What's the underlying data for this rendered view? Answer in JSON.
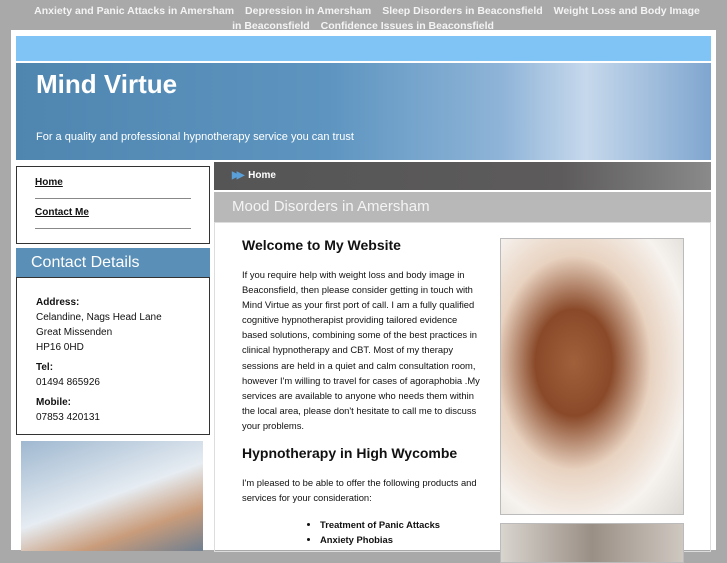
{
  "topnav": [
    "Anxiety and Panic Attacks in Amersham",
    "Depression in Amersham",
    "Sleep Disorders in Beaconsfield",
    "Weight Loss and Body Image in Beaconsfield",
    "Confidence Issues in Beaconsfield"
  ],
  "header": {
    "title": "Mind Virtue",
    "tagline": "For a quality and professional hypnotherapy service you can trust"
  },
  "menu": [
    "Home",
    "Contact Me"
  ],
  "contact": {
    "heading": "Contact Details",
    "address_label": "Address:",
    "address": [
      "Celandine, Nags Head Lane",
      "Great Missenden",
      "HP16 0HD"
    ],
    "tel_label": "Tel:",
    "tel": "01494 865926",
    "mobile_label": "Mobile:",
    "mobile": "07853 420131"
  },
  "breadcrumb": "Home",
  "page_title": "Mood Disorders in Amersham",
  "content": {
    "h1": "Welcome to My Website",
    "p1": "If you require help with weight loss and body image in Beaconsfield, then please consider getting in touch with Mind Virtue as your first port of call. I am a fully qualified cognitive hypnotherapist providing tailored evidence based solutions, combining some of the best practices in clinical hypnotherapy and CBT. Most of my therapy sessions are held in a quiet and calm consultation room, however I'm willing to travel for cases of agoraphobia .My services are available to anyone who needs them within the local area, please don't hesitate to call me to discuss your problems.",
    "h2": "Hypnotherapy in High Wycombe",
    "p2": "I'm pleased to be able to offer the following products and services for your consideration:",
    "list": [
      "Treatment of Panic Attacks",
      "Anxiety Phobias"
    ]
  }
}
